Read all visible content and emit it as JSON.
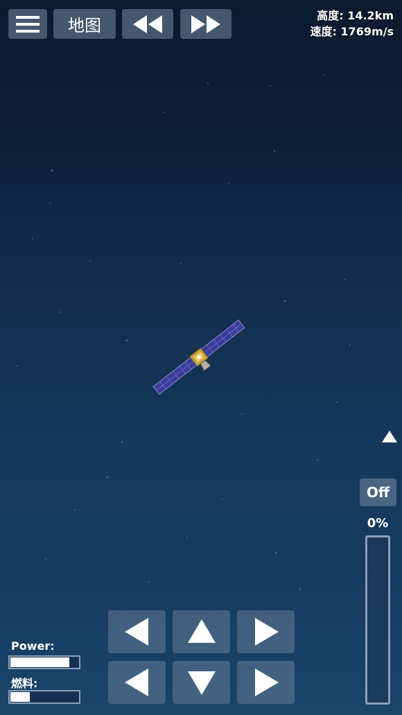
{
  "top_bar": {
    "menu_icon": "hamburger-icon",
    "map_label": "地图",
    "rewind_icon": "rewind-icon",
    "fast_forward_icon": "fast-forward-icon"
  },
  "telemetry": {
    "altitude_label": "高度:",
    "altitude_value": "14.2km",
    "velocity_label": "速度:",
    "velocity_value": "1769m/s"
  },
  "throttle": {
    "engine_toggle_label": "Off",
    "percent_label": "0%",
    "level": 0
  },
  "resources": {
    "power_label": "Power:",
    "power_level": 0.85,
    "fuel_label": "燃料:",
    "fuel_level": 0.28
  },
  "controls": {
    "top_row": [
      "rotate-left-icon",
      "up-arrow-icon",
      "rotate-right-icon"
    ],
    "bottom_row": [
      "left-arrow-icon",
      "down-arrow-icon",
      "right-arrow-icon"
    ]
  },
  "colors": {
    "button_bg": "#768aa0",
    "panel_blue": "#3a3f9a",
    "body_gold": "#c9a23a"
  }
}
